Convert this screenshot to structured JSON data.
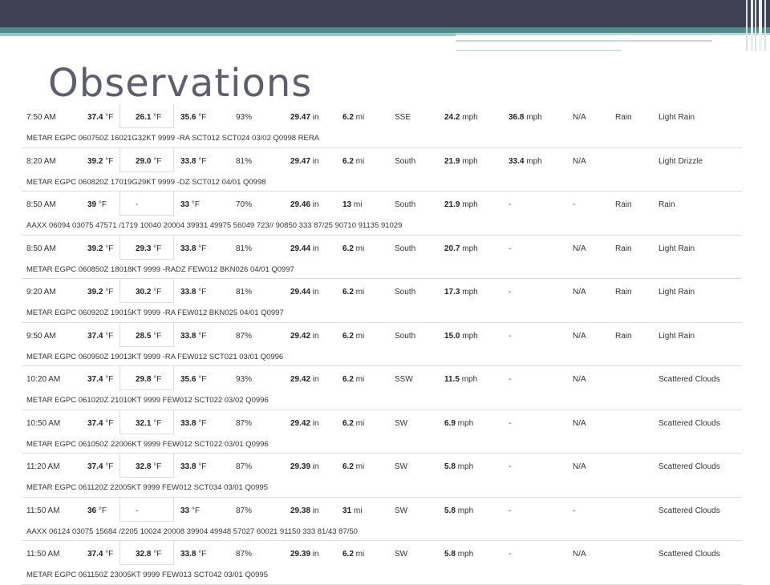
{
  "slide": {
    "title": "Observations"
  },
  "rows": [
    {
      "time": "7:50 AM",
      "temp": "37.4",
      "dew": "26.1",
      "heat": "35.6",
      "hum": "93%",
      "pres": "29.47",
      "vis": "6.2",
      "wdir": "SSE",
      "wspd": "24.2",
      "gust": "36.8",
      "prec": "N/A",
      "evt": "Rain",
      "cond": "Light Rain",
      "metar": "METAR EGPC 060750Z 16021G32KT 9999 -RA SCT012 SCT024 03/02 Q0998 RERA"
    },
    {
      "time": "8:20 AM",
      "temp": "39.2",
      "dew": "29.0",
      "heat": "33.8",
      "hum": "81%",
      "pres": "29.47",
      "vis": "6.2",
      "wdir": "South",
      "wspd": "21.9",
      "gust": "33.4",
      "prec": "N/A",
      "evt": "",
      "cond": "Light Drizzle",
      "metar": "METAR EGPC 060820Z 17019G29KT 9999 -DZ SCT012 04/01 Q0998"
    },
    {
      "time": "8:50 AM",
      "temp": "39",
      "dew": "-",
      "heat": "33",
      "hum": "70%",
      "pres": "29.46",
      "vis": "13",
      "wdir": "South",
      "wspd": "21.9",
      "gust": "-",
      "prec": "-",
      "evt": "Rain",
      "cond": "Rain",
      "metar": "AAXX 06094 03075 47571 /1719 10040 20004 39931 49975 56049 723// 90850 333 87/25 90710 91135 91029"
    },
    {
      "time": "8:50 AM",
      "temp": "39.2",
      "dew": "29.3",
      "heat": "33.8",
      "hum": "81%",
      "pres": "29.44",
      "vis": "6.2",
      "wdir": "South",
      "wspd": "20.7",
      "gust": "-",
      "prec": "N/A",
      "evt": "Rain",
      "cond": "Light Rain",
      "metar": "METAR EGPC 060850Z 18018KT 9999 -RADZ FEW012 BKN026 04/01 Q0997"
    },
    {
      "time": "9:20 AM",
      "temp": "39.2",
      "dew": "30.2",
      "heat": "33.8",
      "hum": "81%",
      "pres": "29.44",
      "vis": "6.2",
      "wdir": "South",
      "wspd": "17.3",
      "gust": "-",
      "prec": "N/A",
      "evt": "Rain",
      "cond": "Light Rain",
      "metar": "METAR EGPC 060920Z 19015KT 9999 -RA FEW012 BKN025 04/01 Q0997"
    },
    {
      "time": "9:50 AM",
      "temp": "37.4",
      "dew": "28.5",
      "heat": "33.8",
      "hum": "87%",
      "pres": "29.42",
      "vis": "6.2",
      "wdir": "South",
      "wspd": "15.0",
      "gust": "-",
      "prec": "N/A",
      "evt": "Rain",
      "cond": "Light Rain",
      "metar": "METAR EGPC 060950Z 19013KT 9999 -RA FEW012 SCT021 03/01 Q0996"
    },
    {
      "time": "10:20 AM",
      "temp": "37.4",
      "dew": "29.8",
      "heat": "35.6",
      "hum": "93%",
      "pres": "29.42",
      "vis": "6.2",
      "wdir": "SSW",
      "wspd": "11.5",
      "gust": "-",
      "prec": "N/A",
      "evt": "",
      "cond": "Scattered Clouds",
      "metar": "METAR EGPC 061020Z 21010KT 9999 FEW012 SCT022 03/02 Q0996"
    },
    {
      "time": "10:50 AM",
      "temp": "37.4",
      "dew": "32.1",
      "heat": "33.8",
      "hum": "87%",
      "pres": "29.42",
      "vis": "6.2",
      "wdir": "SW",
      "wspd": "6.9",
      "gust": "-",
      "prec": "N/A",
      "evt": "",
      "cond": "Scattered Clouds",
      "metar": "METAR EGPC 061050Z 22006KT 9999 FEW012 SCT022 03/01 Q0996"
    },
    {
      "time": "11:20 AM",
      "temp": "37.4",
      "dew": "32.8",
      "heat": "33.8",
      "hum": "87%",
      "pres": "29.39",
      "vis": "6.2",
      "wdir": "SW",
      "wspd": "5.8",
      "gust": "-",
      "prec": "N/A",
      "evt": "",
      "cond": "Scattered Clouds",
      "metar": "METAR EGPC 061120Z 22005KT 9999 FEW012 SCT034 03/01 Q0995"
    },
    {
      "time": "11:50 AM",
      "temp": "36",
      "dew": "-",
      "heat": "33",
      "hum": "87%",
      "pres": "29.38",
      "vis": "31",
      "wdir": "SW",
      "wspd": "5.8",
      "gust": "-",
      "prec": "-",
      "evt": "",
      "cond": "Scattered Clouds",
      "metar": "AAXX 06124 03075 15684 /2205 10024 20008 39904 49948 57027 60021 91150 333 81/43 87/50"
    },
    {
      "time": "11:50 AM",
      "temp": "37.4",
      "dew": "32.8",
      "heat": "33.8",
      "hum": "87%",
      "pres": "29.39",
      "vis": "6.2",
      "wdir": "SW",
      "wspd": "5.8",
      "gust": "-",
      "prec": "N/A",
      "evt": "",
      "cond": "Scattered Clouds",
      "metar": "METAR EGPC 061150Z 23005KT 9999 FEW013 SCT042 03/01 Q0995"
    }
  ]
}
